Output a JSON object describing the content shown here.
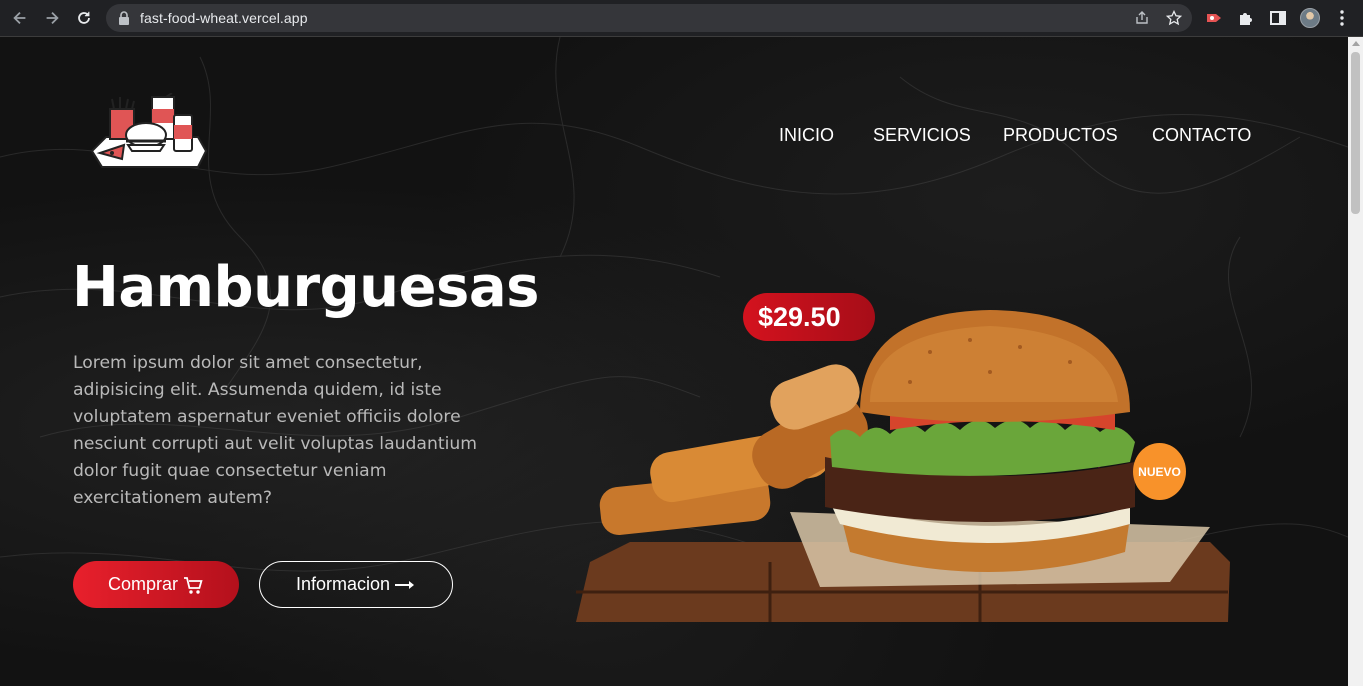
{
  "browser": {
    "url": "fast-food-wheat.vercel.app"
  },
  "nav": {
    "items": [
      {
        "label": "INICIO"
      },
      {
        "label": "SERVICIOS"
      },
      {
        "label": "PRODUCTOS"
      },
      {
        "label": "CONTACTO"
      }
    ]
  },
  "hero": {
    "title": "Hamburguesas",
    "description": "Lorem ipsum dolor sit amet consectetur, adipisicing elit. Assumenda quidem, id iste voluptatem aspernatur eveniet officiis dolore nesciunt corrupti aut velit voluptas laudantium dolor fugit quae consectetur veniam exercitationem autem?",
    "buy_label": "Comprar",
    "info_label": "Informacion",
    "price": "$29.50",
    "badge": "NUEVO"
  },
  "icons": {
    "back": "arrow-left-icon",
    "forward": "arrow-right-icon",
    "reload": "reload-icon",
    "lock": "lock-icon",
    "share": "share-icon",
    "bookmark": "star-icon",
    "extension": "puzzle-icon",
    "sidepanel": "side-panel-icon",
    "menu": "kebab-menu-icon",
    "cart": "cart-icon",
    "arrow": "long-arrow-right-icon"
  },
  "colors": {
    "accent_red": "#e8202c",
    "badge_orange": "#f8922a",
    "background": "#121212"
  }
}
